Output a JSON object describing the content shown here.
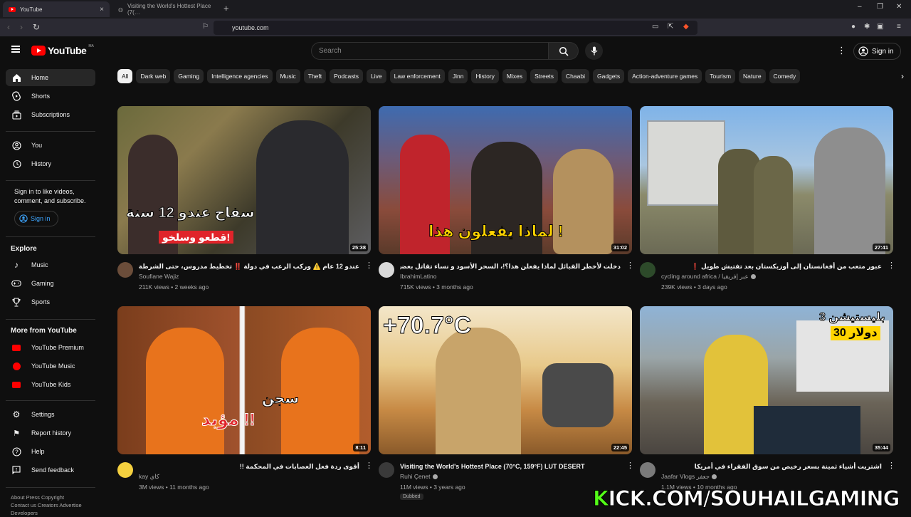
{
  "browser": {
    "tabs": [
      {
        "label": "YouTube",
        "close": "×"
      },
      {
        "label": "Visiting the World's Hottest Place (7(…"
      }
    ],
    "new_tab": "+",
    "url": "youtube.com",
    "window_controls": [
      "–",
      "❐",
      "✕"
    ]
  },
  "header": {
    "logo_text": "YouTube",
    "country_code": "MA",
    "search_placeholder": "Search",
    "signin_label": "Sign in"
  },
  "sidebar": {
    "main": [
      {
        "label": "Home",
        "icon": "home-icon"
      },
      {
        "label": "Shorts",
        "icon": "shorts-icon"
      },
      {
        "label": "Subscriptions",
        "icon": "subscriptions-icon"
      }
    ],
    "you": [
      {
        "label": "You",
        "icon": "you-icon"
      },
      {
        "label": "History",
        "icon": "history-icon"
      }
    ],
    "signin_prompt": "Sign in to like videos, comment, and subscribe.",
    "signin_button": "Sign in",
    "explore_heading": "Explore",
    "explore": [
      {
        "label": "Music",
        "icon": "music-icon"
      },
      {
        "label": "Gaming",
        "icon": "gaming-icon"
      },
      {
        "label": "Sports",
        "icon": "sports-icon"
      }
    ],
    "more_heading": "More from YouTube",
    "more": [
      {
        "label": "YouTube Premium",
        "icon": "youtube-premium-icon"
      },
      {
        "label": "YouTube Music",
        "icon": "youtube-music-icon"
      },
      {
        "label": "YouTube Kids",
        "icon": "youtube-kids-icon"
      }
    ],
    "settings": [
      {
        "label": "Settings",
        "icon": "gear-icon"
      },
      {
        "label": "Report history",
        "icon": "flag-icon"
      },
      {
        "label": "Help",
        "icon": "help-icon"
      },
      {
        "label": "Send feedback",
        "icon": "feedback-icon"
      }
    ],
    "footer_line1": "About  Press  Copyright",
    "footer_line2": "Contact us  Creators  Advertise",
    "footer_line3": "Developers"
  },
  "chips": [
    "All",
    "Dark web",
    "Gaming",
    "Intelligence agencies",
    "Music",
    "Theft",
    "Podcasts",
    "Live",
    "Law enforcement",
    "Jinn",
    "History",
    "Mixes",
    "Streets",
    "Chaabi",
    "Gadgets",
    "Action-adventure games",
    "Tourism",
    "Nature",
    "Comedy"
  ],
  "videos": [
    {
      "title": "عندو 12 عام ⚠️ وركب الرعب في دولة ‼️ تخطيط مدروس، حتى الشرطة تصدمو 🥵",
      "channel": "Soufiane Wajiz",
      "meta": "211K views • 2 weeks ago",
      "duration": "25:38",
      "thumb_text": "سفاح عندو 12 سنة",
      "thumb_sub": "قطعو وسلخو!"
    },
    {
      "title": "دخلت لأخطر القبائل لماذا يفعلن هذا؟!، السحر الأسود و نساء تقاتل بعضها ! 🇧🇴",
      "channel": "IbrahimLatino",
      "meta": "715K views • 3 months ago",
      "duration": "31:02",
      "thumb_text": "لماذا يفعلون هذا !"
    },
    {
      "title": "عبور متعب من أفغانستان إلى أوزبكستان بعد تفتيش طويل ❗",
      "channel": "cycling around africa / عبر إفريقيا",
      "meta": "239K views • 3 days ago",
      "duration": "27:41",
      "verified": true
    },
    {
      "title": "أقوى ردة فعل العصابات في المحكمة !!",
      "channel": "kay كاي",
      "meta": "3M views • 11 months ago",
      "duration": "8:11",
      "thumb_text": "سجن",
      "thumb_sub": "مؤبد !!"
    },
    {
      "title": "Visiting the World's Hottest Place (70°C, 159°F) LUT DESERT",
      "channel": "Ruhi Çenet",
      "meta": "11M views • 3 years ago",
      "duration": "22:45",
      "thumb_text": "+70.7°C",
      "badge": "Dubbed",
      "verified": true
    },
    {
      "title": "اشتريت أشياء ثمينة بسعر رخيص من سوق الفقراء في أمريكا",
      "channel": "Jaafar Vlogs جعفر",
      "meta": "1.1M views • 10 months ago",
      "duration": "35:44",
      "thumb_text": "بليستيشن 3",
      "thumb_sub": "30 دولار",
      "verified": true
    }
  ],
  "watermark": {
    "k": "K",
    "rest": "ICK.COM/SOUHAILGAMING"
  },
  "colors": {
    "brand_red": "#ff0000",
    "link_blue": "#3ea6ff",
    "kick_green": "#53fc18",
    "background": "#0f0f0f"
  }
}
